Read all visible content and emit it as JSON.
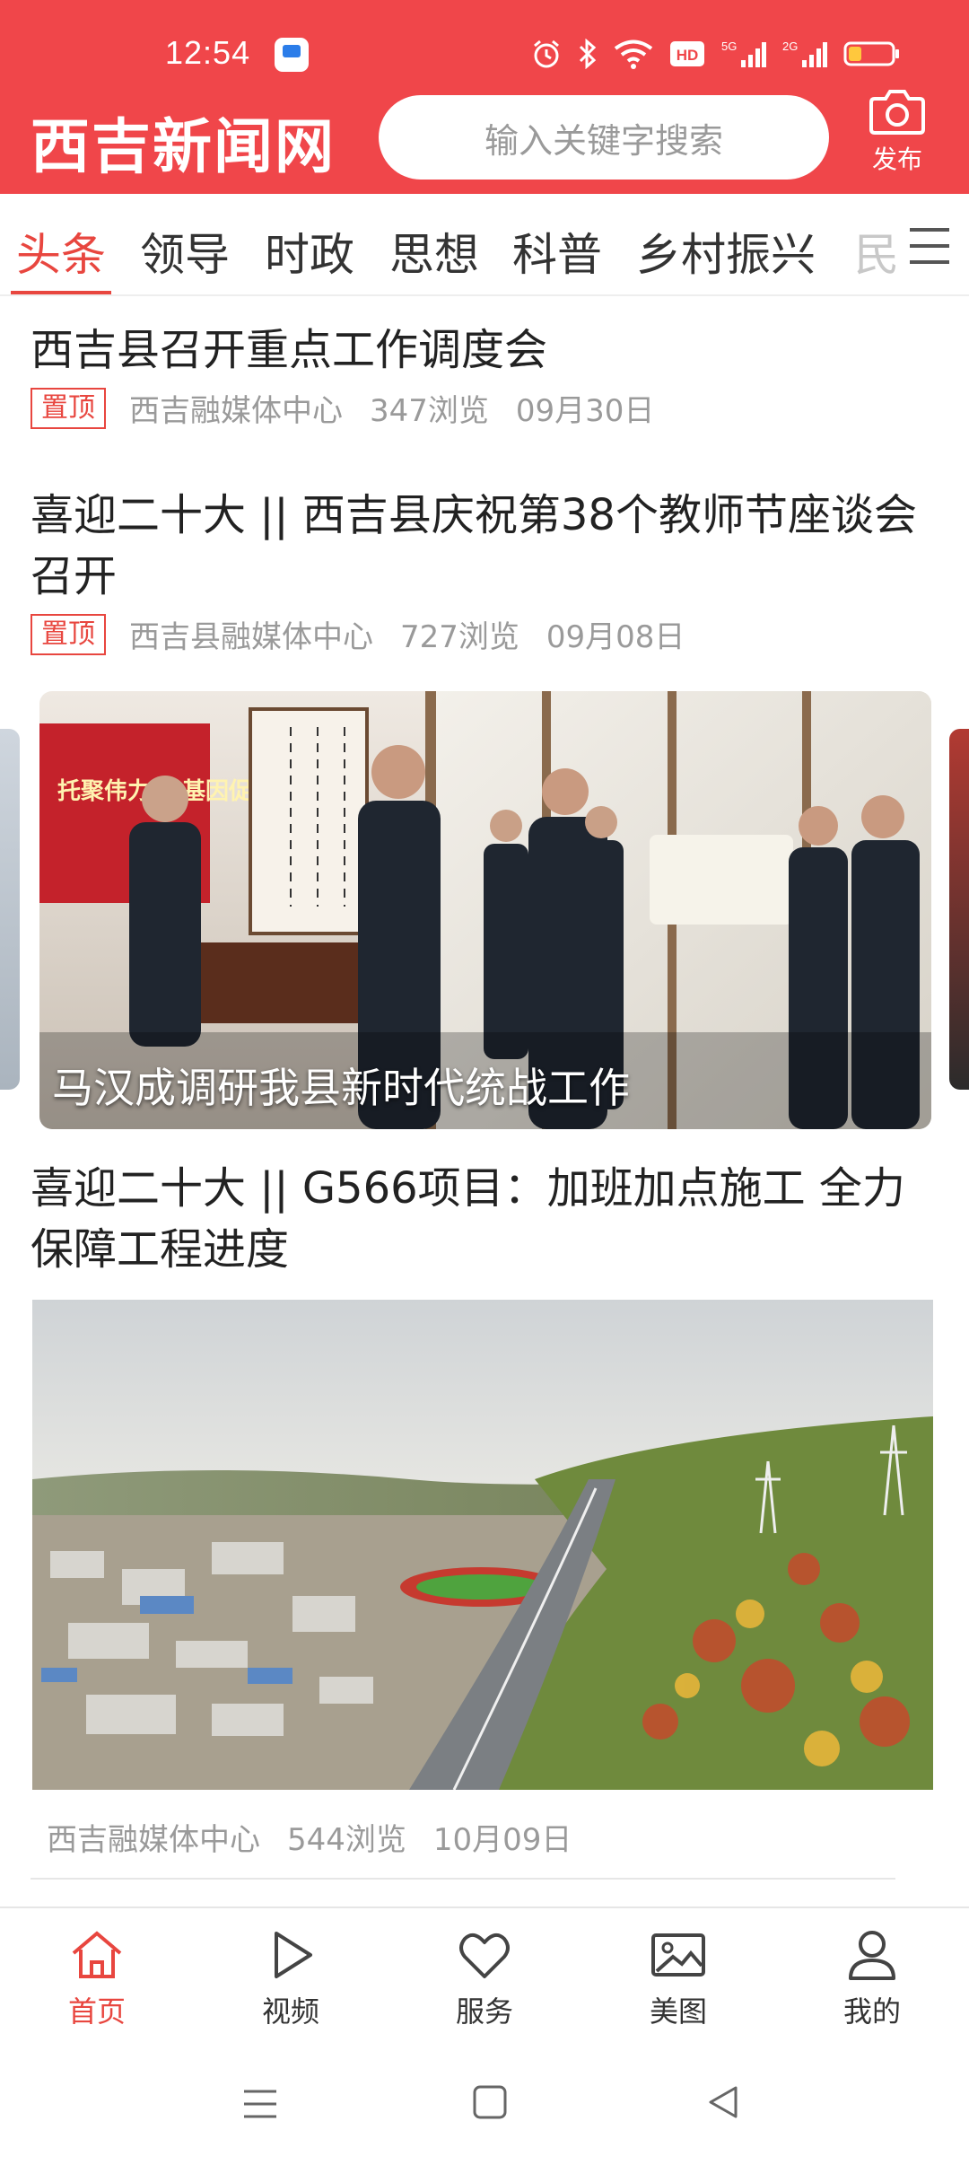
{
  "status_bar": {
    "time": "12:54",
    "icons": [
      "app-badge-icon",
      "alarm-icon",
      "bluetooth-icon",
      "wifi-icon",
      "hd-icon",
      "signal-5g-icon",
      "signal-2g-icon",
      "battery-icon"
    ]
  },
  "header": {
    "logo": "西吉新闻网",
    "search_placeholder": "输入关键字搜索",
    "publish_label": "发布",
    "bg_color": "#f0464a"
  },
  "tabs": {
    "items": [
      "头条",
      "领导",
      "时政",
      "思想",
      "科普",
      "乡村振兴",
      "民"
    ],
    "active_index": 0,
    "accent_color": "#e8463f"
  },
  "feed": {
    "articles": [
      {
        "title": "西吉县召开重点工作调度会",
        "pin_label": "置顶",
        "source": "西吉融媒体中心",
        "views": "347浏览",
        "date": "09月30日"
      },
      {
        "title": "喜迎二十大 || 西吉县庆祝第38个教师节座谈会召开",
        "pin_label": "置顶",
        "source": "西吉县融媒体中心",
        "views": "727浏览",
        "date": "09月08日"
      }
    ],
    "carousel": {
      "caption": "马汉成调研我县新时代统战工作",
      "banner_text": "托聚伟力 色基因促"
    },
    "image_article": {
      "title": "喜迎二十大 || G566项目：加班加点施工 全力保障工程进度",
      "source": "西吉融媒体中心",
      "views": "544浏览",
      "date": "10月09日"
    }
  },
  "bottom_nav": {
    "items": [
      {
        "label": "首页",
        "icon": "home-icon"
      },
      {
        "label": "视频",
        "icon": "play-icon"
      },
      {
        "label": "服务",
        "icon": "heart-icon"
      },
      {
        "label": "美图",
        "icon": "image-icon"
      },
      {
        "label": "我的",
        "icon": "user-icon"
      }
    ],
    "active_index": 0
  },
  "system_nav": {
    "buttons": [
      "menu-icon",
      "home-square-icon",
      "back-icon"
    ]
  }
}
